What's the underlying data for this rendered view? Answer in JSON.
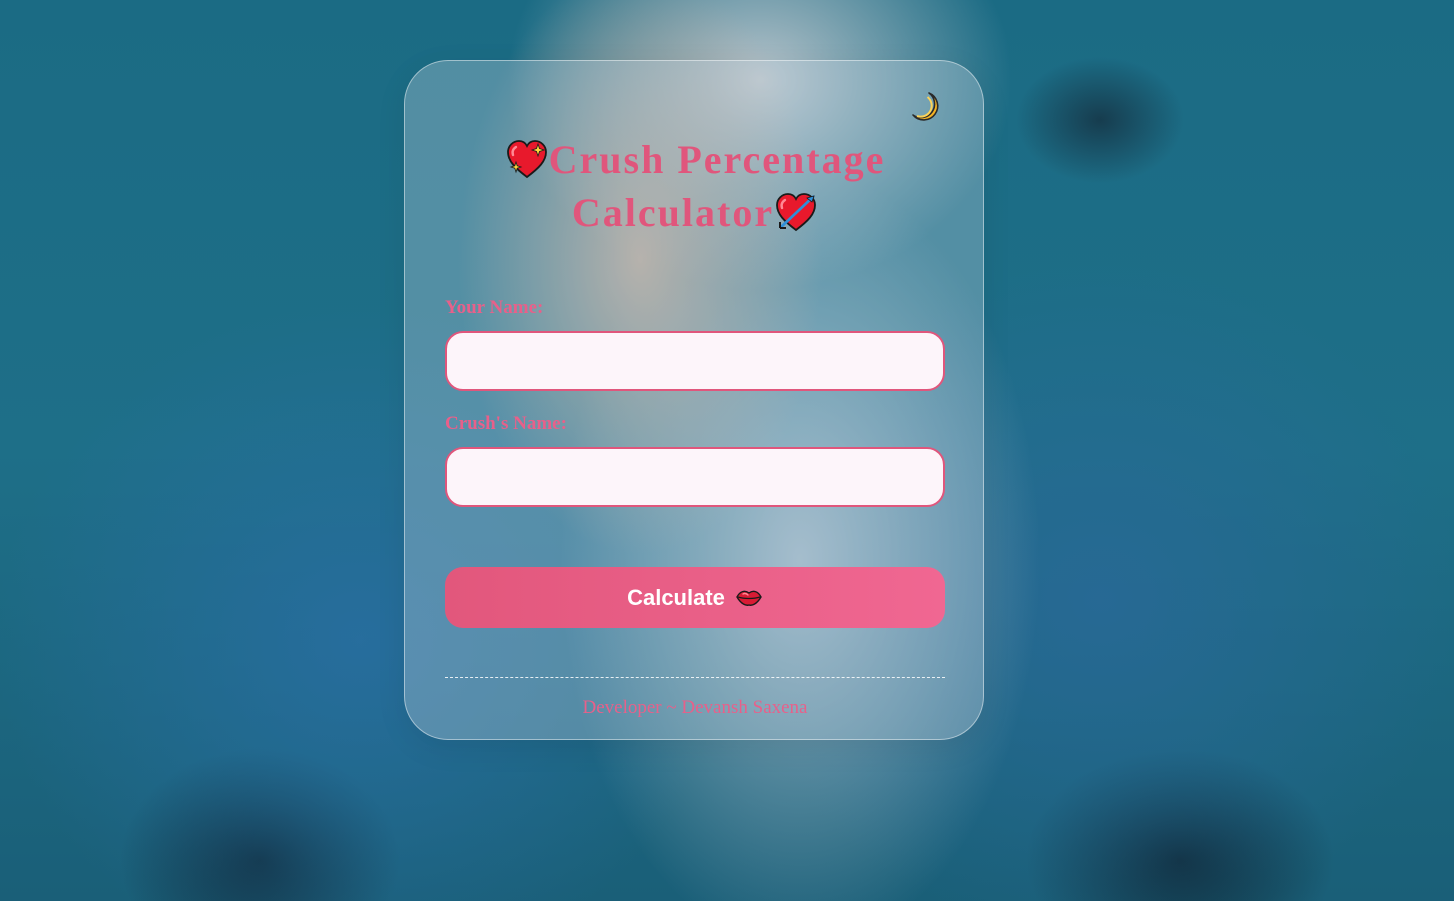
{
  "page": {
    "title_text": "Crush Percentage Calculator",
    "title_line1": "Crush Percentage",
    "title_line2": "Calculator"
  },
  "theme_toggle": {
    "icon": "crescent-moon-icon"
  },
  "title_icons": {
    "leading": "sparkling-heart-icon",
    "trailing": "heart-with-arrow-icon"
  },
  "form": {
    "your_name_label": "Your Name:",
    "your_name_value": "",
    "crush_name_label": "Crush's Name:",
    "crush_name_value": "",
    "calculate_label": "Calculate",
    "calculate_icon": "kiss-mark-icon"
  },
  "footer": {
    "credit": "Developer ~ Devansh Saxena"
  },
  "colors": {
    "accent": "#e0567c",
    "button_start": "#e2577c",
    "button_end": "#f06792",
    "input_bg": "#fdf5fa"
  }
}
